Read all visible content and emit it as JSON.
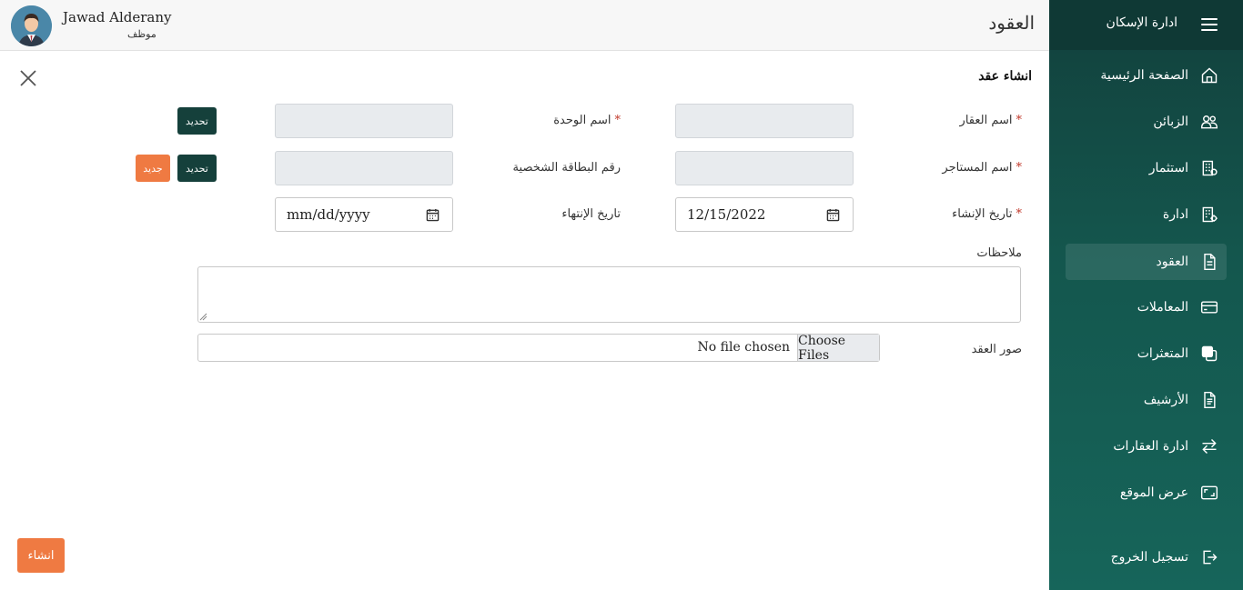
{
  "header": {
    "user_name": "Jawad Alderany",
    "user_role": "موظف",
    "page_title": "العقود"
  },
  "sidebar": {
    "brand": "ادارة الإسكان",
    "items": [
      {
        "label": "الصفحة الرئيسية",
        "icon": "home-icon"
      },
      {
        "label": "الزبائن",
        "icon": "users-icon"
      },
      {
        "label": "استثمار",
        "icon": "building-icon"
      },
      {
        "label": "ادارة",
        "icon": "building-gear-icon"
      },
      {
        "label": "العقود",
        "icon": "document-icon",
        "active": true
      },
      {
        "label": "المعاملات",
        "icon": "credit-card-icon"
      },
      {
        "label": "المتعثرات",
        "icon": "copy-icon"
      },
      {
        "label": "الأرشيف",
        "icon": "file-text-icon"
      },
      {
        "label": "ادارة العقارات",
        "icon": "arrows-exchange-icon"
      },
      {
        "label": "عرض الموقع",
        "icon": "screen-icon"
      },
      {
        "label": "تسجيل الخروج",
        "icon": "logout-icon"
      }
    ]
  },
  "form": {
    "title": "انشاء عقد",
    "property_name_label": "اسم العقار",
    "unit_name_label": "اسم الوحدة",
    "tenant_name_label": "اسم المستاجر",
    "id_number_label": "رقم البطاقة الشخصية",
    "start_date_label": "تاريخ الإنشاء",
    "start_date_value": "12/15/2022",
    "end_date_label": "تاريخ الإنتهاء",
    "end_date_placeholder": "mm/dd/yyyy",
    "required_mark": "*",
    "select_label": "تحديد",
    "new_label": "جديد",
    "notes_label": "ملاحظات",
    "contract_images_label": "صور العقد",
    "choose_files_label": "Choose Files",
    "no_file_label": "No file chosen",
    "submit_label": "انشاء"
  },
  "colors": {
    "sidebar_dark": "#0f3935",
    "sidebar_gradient_end": "#16655a",
    "button_dark": "#15403b",
    "button_orange": "#ef7a42",
    "required_red": "#c0392b"
  }
}
